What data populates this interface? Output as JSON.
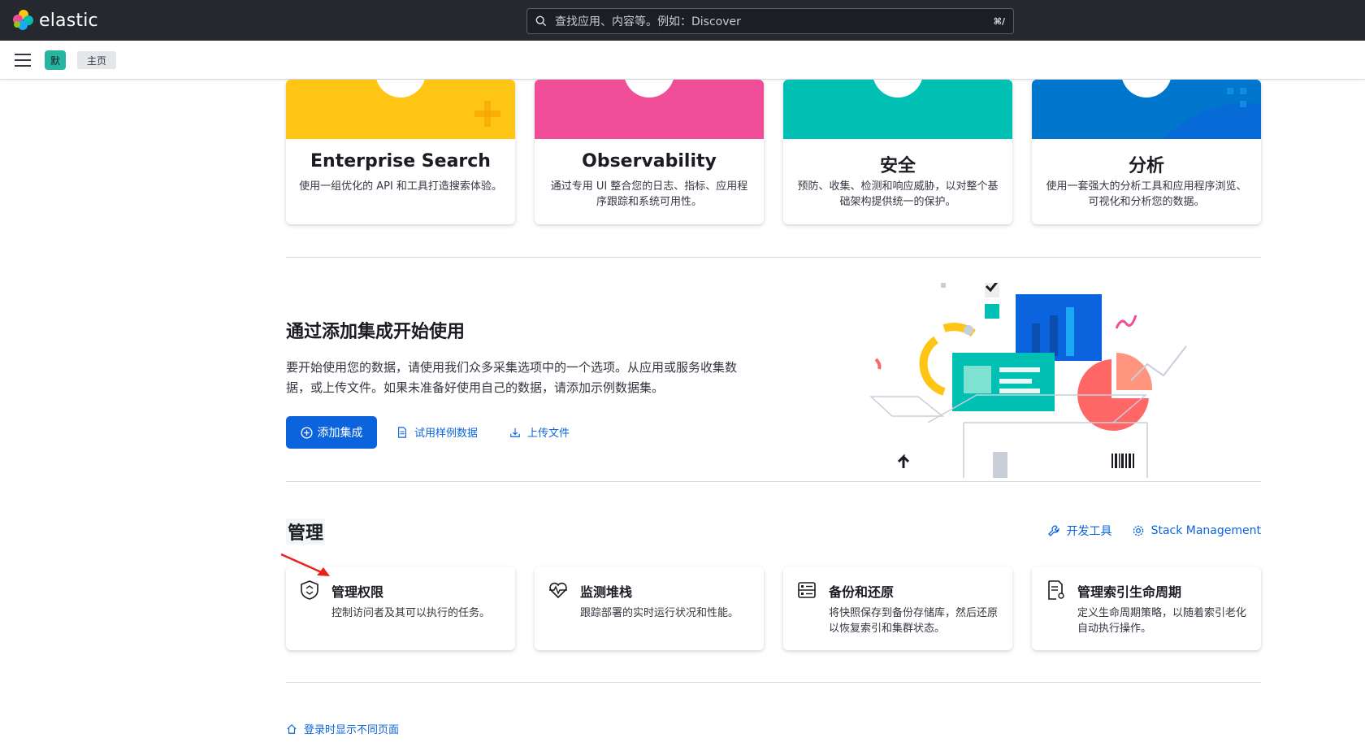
{
  "header": {
    "logo_text": "elastic",
    "search_placeholder": "查找应用、内容等。例如：Discover",
    "search_shortcut": "⌘/"
  },
  "subheader": {
    "space_badge": "默",
    "breadcrumb": "主页"
  },
  "solutions": [
    {
      "title": "Enterprise Search",
      "desc": "使用一组优化的 API 和工具打造搜索体验。",
      "color": "#fec514"
    },
    {
      "title": "Observability",
      "desc": "通过专用 UI 整合您的日志、指标、应用程序跟踪和系统可用性。",
      "color": "#f04e98"
    },
    {
      "title": "安全",
      "desc": "预防、收集、检测和响应威胁，以对整个基础架构提供统一的保护。",
      "color": "#00bfb3"
    },
    {
      "title": "分析",
      "desc": "使用一套强大的分析工具和应用程序浏览、可视化和分析您的数据。",
      "color": "#0077cc"
    }
  ],
  "integrations": {
    "title": "通过添加集成开始使用",
    "desc": "要开始使用您的数据，请使用我们众多采集选项中的一个选项。从应用或服务收集数据，或上传文件。如果未准备好使用自己的数据，请添加示例数据集。",
    "add_button": "添加集成",
    "sample_link": "试用样例数据",
    "upload_link": "上传文件"
  },
  "management": {
    "title": "管理",
    "dev_tools": "开发工具",
    "stack_management": "Stack Management",
    "cards": [
      {
        "title": "管理权限",
        "desc": "控制访问者及其可以执行的任务。"
      },
      {
        "title": "监测堆栈",
        "desc": "跟踪部署的实时运行状况和性能。"
      },
      {
        "title": "备份和还原",
        "desc": "将快照保存到备份存储库，然后还原以恢复索引和集群状态。"
      },
      {
        "title": "管理索引生命周期",
        "desc": "定义生命周期策略，以随着索引老化自动执行操作。"
      }
    ]
  },
  "footer": {
    "link": "登录时显示不同页面"
  }
}
